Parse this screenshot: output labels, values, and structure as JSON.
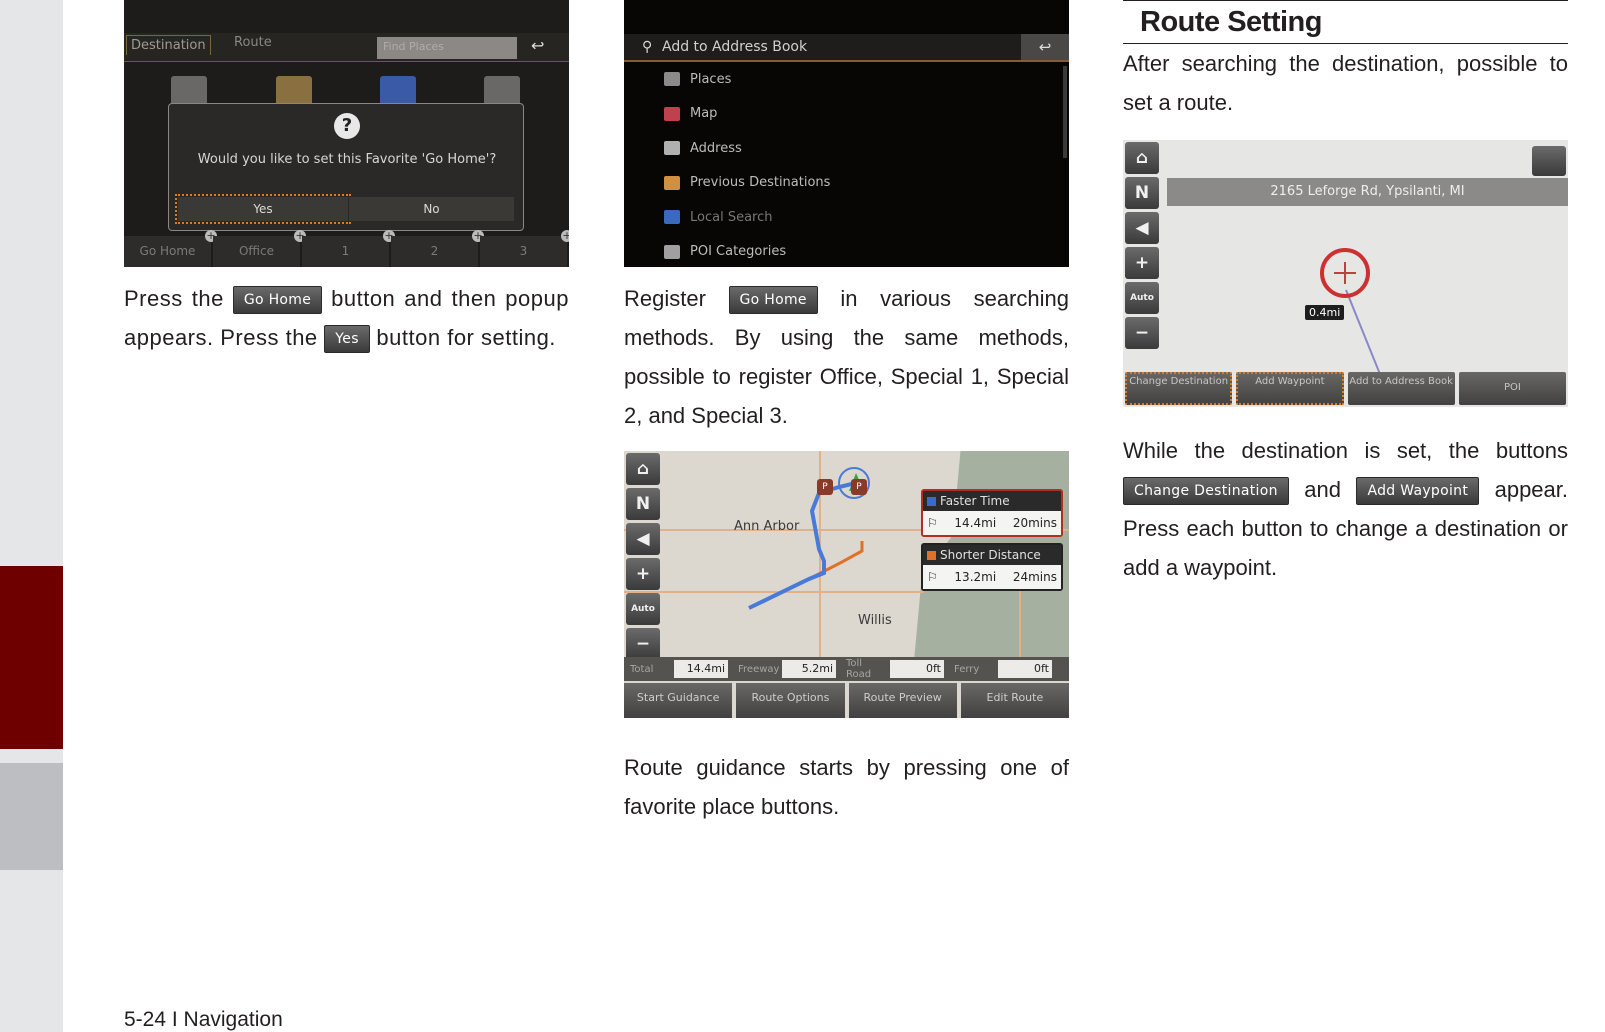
{
  "footer": {
    "page_label": "5-24 I Navigation"
  },
  "colors": {
    "sidebar_bg": "#e5e6e8",
    "section_tab_active": "#6f0000",
    "section_tab_inactive": "#bdbec2",
    "highlight_outline": "#e07a20"
  },
  "column1": {
    "screen": {
      "tabs": [
        "Destination",
        "Route"
      ],
      "search_placeholder": "Find Places",
      "back_icon": "back-arrow-icon",
      "popup": {
        "icon": "question-icon",
        "message": "Would you like to set this Favorite 'Go Home'?",
        "yes_label": "Yes",
        "no_label": "No"
      },
      "favorites": [
        "Go Home",
        "Office",
        "1",
        "2",
        "3"
      ]
    },
    "text": {
      "part1": "Press the",
      "btn_go_home": "Go Home",
      "part2": "button and then popup appears. Press the",
      "btn_yes": "Yes",
      "part3": "button for setting."
    }
  },
  "column2": {
    "menu_screen": {
      "header": "Add to Address Book",
      "back_icon": "back-arrow-icon",
      "items": [
        {
          "label": "Places",
          "icon": "places-icon",
          "color": "#8a8a8a",
          "disabled": false
        },
        {
          "label": "Map",
          "icon": "map-icon",
          "color": "#c04050",
          "disabled": false
        },
        {
          "label": "Address",
          "icon": "address-icon",
          "color": "#b0b0b0",
          "disabled": false
        },
        {
          "label": "Previous Destinations",
          "icon": "folder-icon",
          "color": "#d09040",
          "disabled": false
        },
        {
          "label": "Local Search",
          "icon": "local-search-icon",
          "color": "#3a6ac0",
          "disabled": true
        },
        {
          "label": "POI Categories",
          "icon": "poi-icon",
          "color": "#a0a0a0",
          "disabled": false
        }
      ]
    },
    "text1": {
      "part1": "Register",
      "btn_go_home": "Go Home",
      "part2": "in various searching methods. By using the same methods, possible to register Office, Special 1, Special 2, and Special 3."
    },
    "route_screen": {
      "cities": [
        "Ann Arbor",
        "Willis"
      ],
      "routes": [
        {
          "name": "Faster Time",
          "distance": "14.4mi",
          "time": "20mins",
          "color": "#3a6ad0"
        },
        {
          "name": "Shorter Distance",
          "distance": "13.2mi",
          "time": "24mins",
          "color": "#e0702a"
        }
      ],
      "stats": [
        {
          "label": "Total",
          "value": "14.4mi"
        },
        {
          "label": "Freeway",
          "value": "5.2mi"
        },
        {
          "label": "Toll Road",
          "value": "0ft"
        },
        {
          "label": "Ferry",
          "value": "0ft"
        }
      ],
      "actions": [
        "Start Guidance",
        "Route Options",
        "Route Preview",
        "Edit Route"
      ]
    },
    "text2": "Route guidance starts by pressing one of favorite place buttons."
  },
  "column3": {
    "title": "Route Setting",
    "intro": "After searching the destination, possible to set a route.",
    "screen": {
      "address": "2165 Leforge Rd, Ypsilanti, MI",
      "distance_label": "0.4mi",
      "buttons": [
        {
          "label": "Change Destination",
          "highlighted": true
        },
        {
          "label": "Add Waypoint",
          "highlighted": true
        },
        {
          "label": "Add to Address Book",
          "highlighted": false
        },
        {
          "label": "POI",
          "highlighted": false
        }
      ]
    },
    "text": {
      "part1": "While the destination is set, the buttons",
      "btn_change": "Change Destination",
      "and": "and",
      "btn_waypoint": "Add Waypoint",
      "part2": "appear. Press each button to change a destination or add a waypoint."
    }
  },
  "map_side_buttons": [
    {
      "icon": "home-icon",
      "glyph": "⌂"
    },
    {
      "icon": "compass-icon",
      "glyph": "N"
    },
    {
      "icon": "volume-icon",
      "glyph": "◀"
    },
    {
      "icon": "zoom-in-icon",
      "glyph": "+"
    },
    {
      "icon": "auto-scale-icon",
      "glyph": "Auto"
    },
    {
      "icon": "zoom-out-icon",
      "glyph": "−"
    }
  ]
}
